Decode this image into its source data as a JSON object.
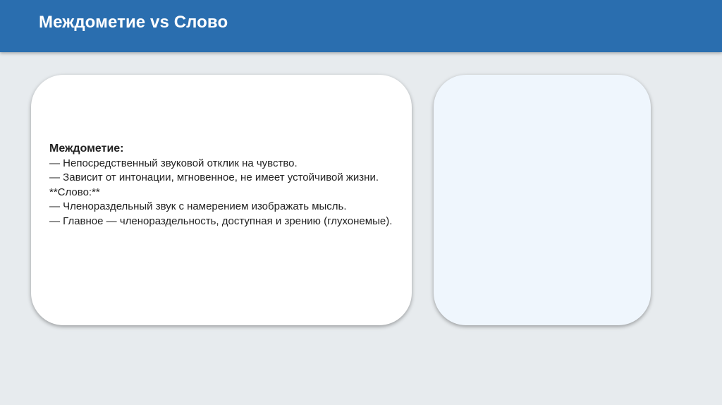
{
  "slide": {
    "title": "Междометие vs Слово"
  },
  "left_card": {
    "heading": "Междометие:",
    "lines": [
      "— Непосредственный звуковой отклик на чувство.",
      "— Зависит от интонации, мгновенное, не имеет устойчивой жизни.",
      "**Слово:**",
      "— Членораздельный звук с намерением изображать мысль.",
      "— Главное — членораздельность, доступная и зрению (глухонемые)."
    ]
  },
  "colors": {
    "header": "#2a6eaf",
    "background": "#e7ebee",
    "right_card": "#eff6fd"
  }
}
